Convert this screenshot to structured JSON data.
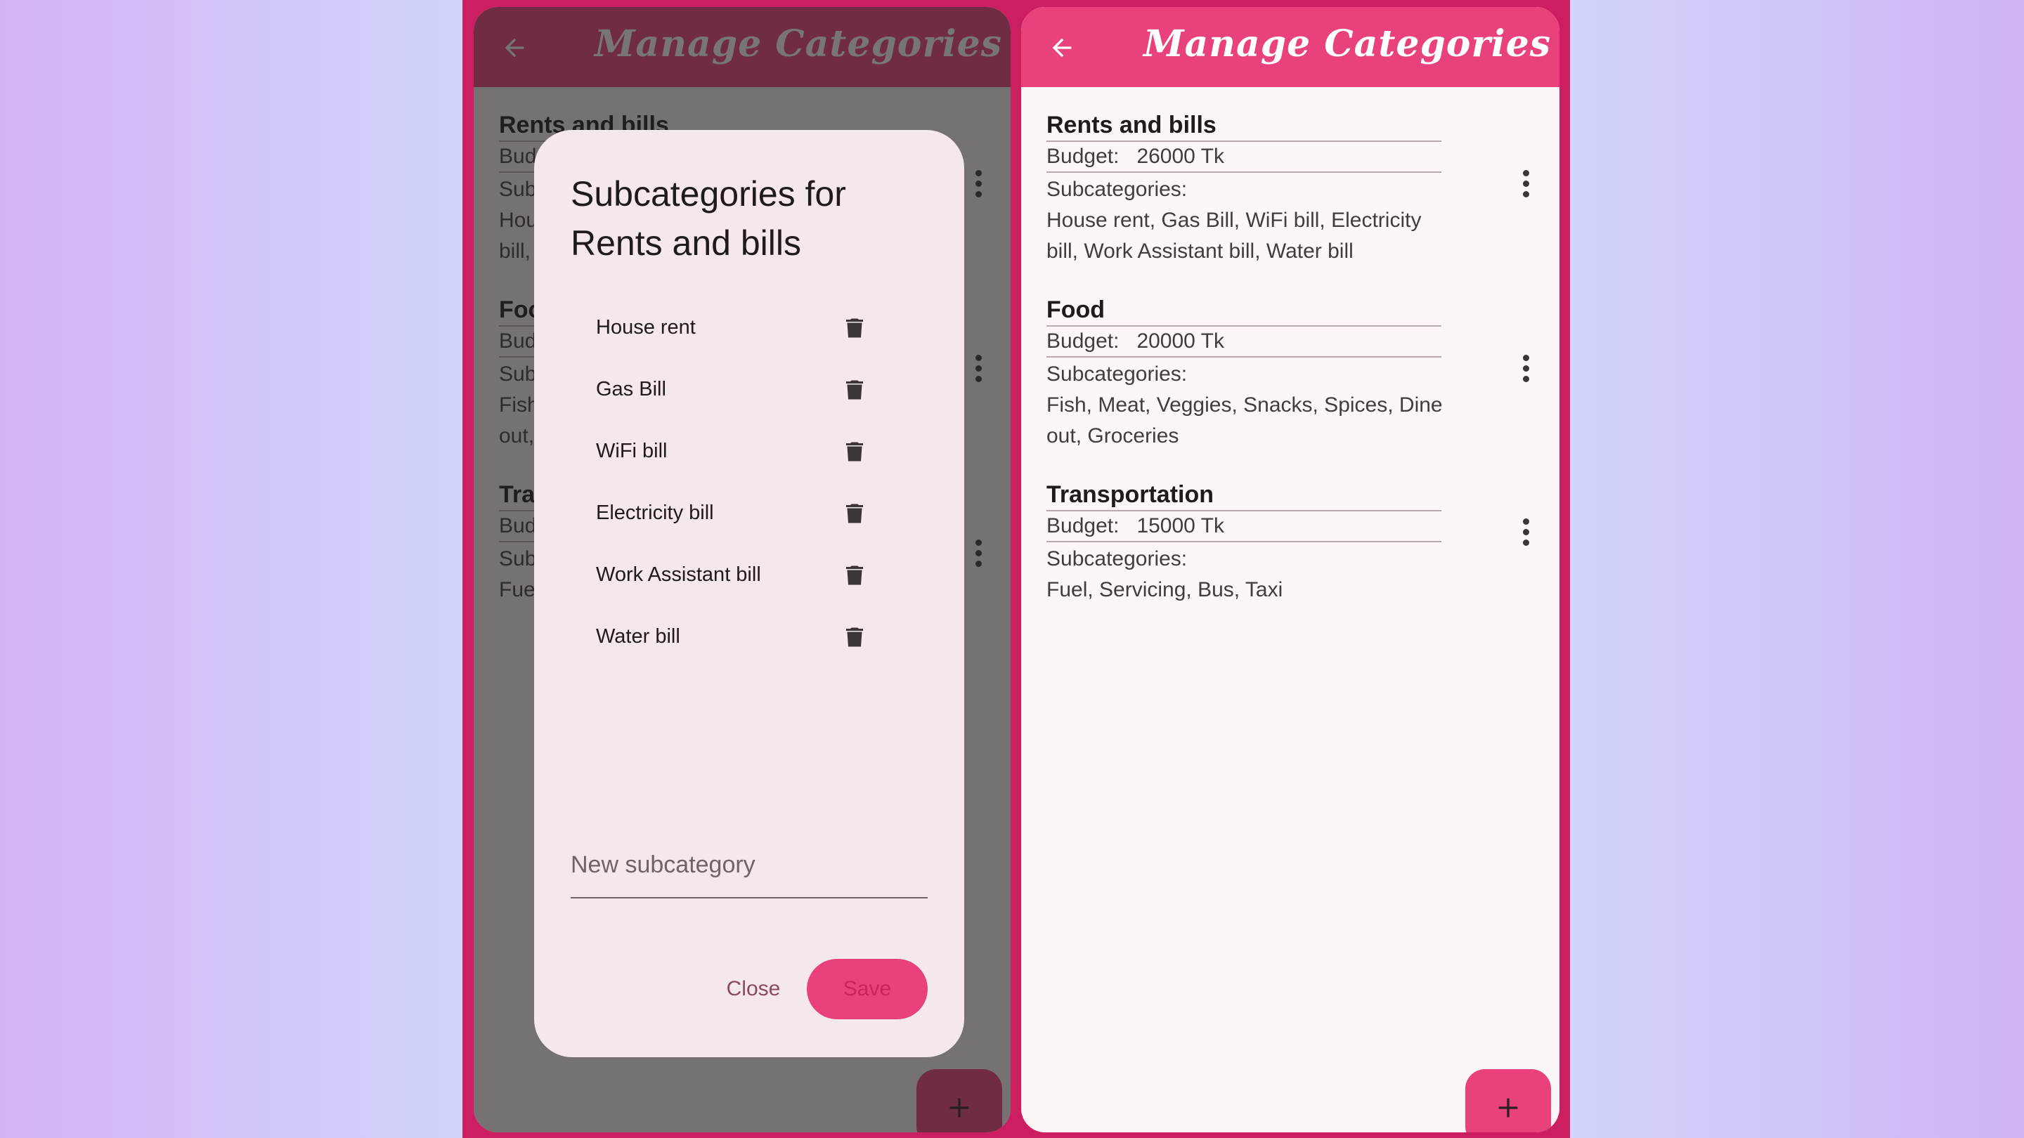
{
  "app": {
    "title": "Manage Categories",
    "accent_color": "#e9417c",
    "frame_color": "#cc1f62"
  },
  "icons": {
    "back": "arrow-left-icon",
    "more": "more-vertical-icon",
    "delete": "trash-icon",
    "add": "plus-icon"
  },
  "categories": [
    {
      "name": "Rents and bills",
      "budget_label": "Budget:",
      "budget_value": "26000 Tk",
      "subcategories_label": "Subcategories:",
      "subcategories": "House rent, Gas Bill, WiFi bill, Electricity bill, Work Assistant bill, Water bill"
    },
    {
      "name": "Food",
      "budget_label": "Budget:",
      "budget_value": "20000 Tk",
      "subcategories_label": "Subcategories:",
      "subcategories": "Fish, Meat, Veggies, Snacks, Spices, Dine out, Groceries"
    },
    {
      "name": "Transportation",
      "budget_label": "Budget:",
      "budget_value": "15000 Tk",
      "subcategories_label": "Subcategories:",
      "subcategories": "Fuel, Servicing, Bus, Taxi"
    }
  ],
  "dialog": {
    "title": "Subcategories for Rents and bills",
    "items": [
      "House rent",
      "Gas Bill",
      "WiFi bill",
      "Electricity bill",
      "Work Assistant bill",
      "Water bill"
    ],
    "new_placeholder": "New subcategory",
    "close_label": "Close",
    "save_label": "Save"
  }
}
